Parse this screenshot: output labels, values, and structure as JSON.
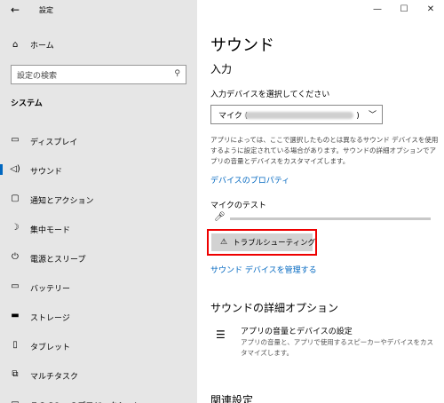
{
  "window": {
    "title": "設定",
    "back_icon": "back-arrow-icon"
  },
  "sidebar": {
    "home": "ホーム",
    "search_placeholder": "設定の検索",
    "section": "システム",
    "items": [
      {
        "label": "ディスプレイ",
        "icon": "display-icon",
        "glyph": "▭"
      },
      {
        "label": "サウンド",
        "icon": "speaker-icon",
        "glyph": "◁)"
      },
      {
        "label": "通知とアクション",
        "icon": "notification-icon",
        "glyph": "▢"
      },
      {
        "label": "集中モード",
        "icon": "moon-icon",
        "glyph": "☽"
      },
      {
        "label": "電源とスリープ",
        "icon": "power-icon",
        "glyph": "⏻"
      },
      {
        "label": "バッテリー",
        "icon": "battery-icon",
        "glyph": "▭"
      },
      {
        "label": "ストレージ",
        "icon": "storage-icon",
        "glyph": "▬"
      },
      {
        "label": "タブレット",
        "icon": "tablet-icon",
        "glyph": "▯"
      },
      {
        "label": "マルチタスク",
        "icon": "multitask-icon",
        "glyph": "⧉"
      },
      {
        "label": "この PC へのプロジェクション",
        "icon": "projection-icon",
        "glyph": "▭"
      }
    ],
    "active_item": "サウンド"
  },
  "main": {
    "title": "サウンド",
    "input_heading": "入力",
    "device_label": "入力デバイスを選択してください",
    "device_value": "マイク (",
    "device_suffix": ")",
    "description": "アプリによっては、ここで選択したものとは異なるサウンド デバイスを使用するように設定されている場合があります。サウンドの詳細オプションでアプリの音量とデバイスをカスタマイズします。",
    "device_properties_link": "デバイスのプロパティ",
    "mic_test_label": "マイクのテスト",
    "mic_level": 0,
    "troubleshoot_label": "トラブルシューティング",
    "manage_devices_link": "サウンド デバイスを管理する",
    "advanced_heading": "サウンドの詳細オプション",
    "advanced_item_title": "アプリの音量とデバイスの設定",
    "advanced_item_desc": "アプリの音量と、アプリで使用するスピーカーやデバイスをカスタマイズします。",
    "related_heading": "関連設定"
  },
  "window_controls": {
    "minimize": "—",
    "maximize": "☐",
    "close": "✕"
  },
  "colors": {
    "accent": "#0067c0",
    "highlight": "#ee0000"
  }
}
